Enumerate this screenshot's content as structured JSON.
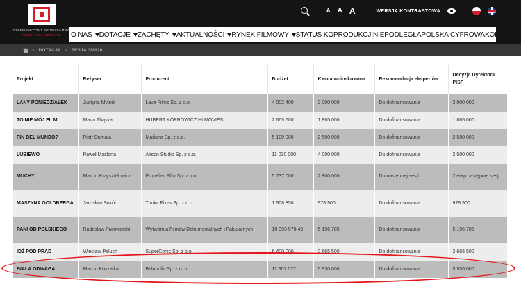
{
  "logo": {
    "line1": "POLSKI INSTYTUT SZTUKI FILMOWEJ",
    "line2": "POLISH FILM INSTITUTE"
  },
  "top_tools": {
    "font_small": "A",
    "font_medium": "A",
    "font_large": "A",
    "contrast_label": "WERSJA KONTRASTOWA"
  },
  "nav": [
    {
      "label": "O NAS",
      "dropdown": true
    },
    {
      "label": "DOTACJE",
      "dropdown": true
    },
    {
      "label": "ZACHĘTY",
      "dropdown": true
    },
    {
      "label": "AKTUALNOŚCI",
      "dropdown": true
    },
    {
      "label": "RYNEK FILMOWY",
      "dropdown": true
    },
    {
      "label": "STATUS KOPRODUKCJI",
      "dropdown": false
    },
    {
      "label": "NIEPODLEGŁA",
      "dropdown": false
    },
    {
      "label": "POLSKA CYFROWA",
      "dropdown": false
    },
    {
      "label": "KORONAWIRUS",
      "dropdown": false
    }
  ],
  "breadcrumbs": {
    "sep": "›",
    "item1": "DOTACJA",
    "item2": "SESJA 3/2020"
  },
  "table": {
    "headers": [
      "Projekt",
      "Reżyser",
      "Producent",
      "Budżet",
      "Kwota wnioskowana",
      "Rekomendacja ekspertów",
      "Decyzja Dyrektora PISF"
    ],
    "rows": [
      [
        "LANY PONIEDZIAŁEK",
        "Justyna Mytnik",
        "Lava Films Sp. z o.o.",
        "4 002 400",
        "2 000 000",
        "Do dofinansowania",
        "2 000 000"
      ],
      [
        "TO NIE MÓJ FILM",
        "Maria Zbąska",
        "HUBERT KOPROWICZ HI MOVIES",
        "2 665 600",
        "1 865 000",
        "Do dofinansowania",
        "1 865 000"
      ],
      [
        "FIN DEL MUNDO?",
        "Piotr Dumała",
        "Mañana Sp. z o.o.",
        "5 100 000",
        "2 500 000",
        "Do dofinansowania",
        "2 500 000"
      ],
      [
        "LUBIEWO",
        "Paweł Maślona",
        "Akson Studio Sp. z o.o.",
        "11 030 000",
        "4 000 000",
        "Do dofinansowania",
        "2 500 000"
      ],
      [
        "MUCHY",
        "Marcin Krzyształowicz",
        "Propeller Film Sp. z o.o.",
        "5 737 000",
        "2 800 000",
        "Do następnej sesji",
        "2 etap następnej sesji"
      ],
      [
        "MASZYNA GOLDBERGA",
        "Jarosław Sokół",
        "Tunka Films Sp. z o.o.",
        "1 908 850",
        "978 900",
        "Do dofinansowania",
        "978 900"
      ],
      [
        "PANI OD POLSKIEGO",
        "Radosław Piwowarski",
        "Wytwórnia Filmów Dokumentalnych i Fabularnych",
        "10 393 570,49",
        "5 196 785",
        "Do dofinansowania",
        "5 196 785"
      ],
      [
        "IDŹ POD PRĄD",
        "Wiesław Paluch",
        "SuperConic Sp. z o.o.",
        "6 400 000",
        "2 665 500",
        "Do dofinansowania",
        "2 665 500"
      ],
      [
        "BIAŁA ODWAGA",
        "Marcin Koszałka",
        "Balapolis Sp. z o. o.",
        "11 907 027",
        "5 930 000",
        "Do dofinansowania",
        "5 930 000"
      ]
    ]
  },
  "colors": {
    "header_bg": "#141414",
    "brand_red": "#d21f28",
    "row_dark": "#bcbcbc",
    "row_light": "#ededed",
    "highlight_oval": "#e3161b"
  }
}
